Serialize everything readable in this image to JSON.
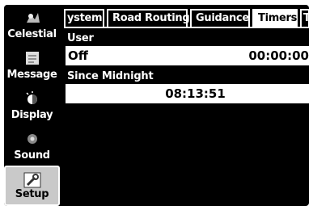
{
  "sidebar": {
    "items": [
      {
        "label": "Celestial",
        "icon": "celestial-icon"
      },
      {
        "label": "Message",
        "icon": "message-icon"
      },
      {
        "label": "Display",
        "icon": "display-icon"
      },
      {
        "label": "Sound",
        "icon": "sound-icon"
      },
      {
        "label": "Setup",
        "icon": "setup-icon",
        "selected": true
      }
    ]
  },
  "tabs": [
    {
      "label": "ystem"
    },
    {
      "label": "Road Routing"
    },
    {
      "label": "Guidance"
    },
    {
      "label": "Timers",
      "active": true
    },
    {
      "label": "T"
    }
  ],
  "timers": {
    "user_label": "User",
    "user_mode": "Off",
    "user_time": "00:00:00",
    "since_midnight_label": "Since Midnight",
    "since_midnight_time": "08:13:51"
  }
}
